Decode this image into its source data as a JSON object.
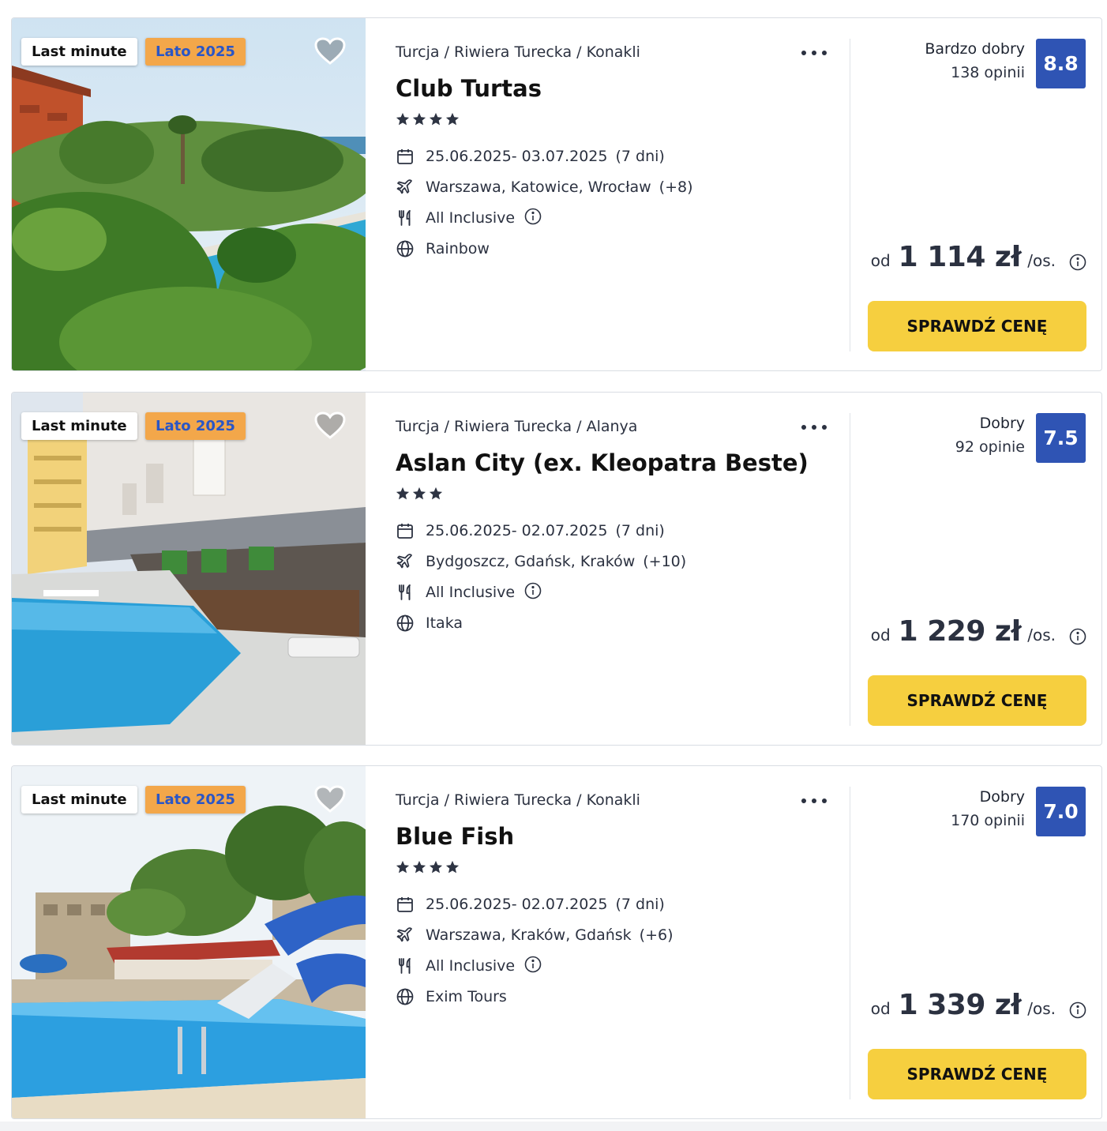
{
  "offers": [
    {
      "badges": {
        "last_minute": "Last minute",
        "season": "Lato 2025"
      },
      "breadcrumb": "Turcja / Riwiera Turecka / Konakli",
      "hotel_name": "Club Turtas",
      "stars": 4,
      "dates": "25.06.2025- 03.07.2025",
      "duration": "(7 dni)",
      "airports": "Warszawa, Katowice, Wrocław",
      "airports_extra": "(+8)",
      "board": "All Inclusive",
      "operator": "Rainbow",
      "rating_label": "Bardzo dobry",
      "review_count": "138 opinii",
      "score": "8.8",
      "price_prefix": "od",
      "price": "1 114 zł",
      "price_suffix": "/os.",
      "cta_label": "SPRAWDŹ CENĘ"
    },
    {
      "badges": {
        "last_minute": "Last minute",
        "season": "Lato 2025"
      },
      "breadcrumb": "Turcja / Riwiera Turecka / Alanya",
      "hotel_name": "Aslan City (ex. Kleopatra Beste)",
      "stars": 3,
      "dates": "25.06.2025- 02.07.2025",
      "duration": "(7 dni)",
      "airports": "Bydgoszcz, Gdańsk, Kraków",
      "airports_extra": "(+10)",
      "board": "All Inclusive",
      "operator": "Itaka",
      "rating_label": "Dobry",
      "review_count": "92 opinie",
      "score": "7.5",
      "price_prefix": "od",
      "price": "1 229 zł",
      "price_suffix": "/os.",
      "cta_label": "SPRAWDŹ CENĘ"
    },
    {
      "badges": {
        "last_minute": "Last minute",
        "season": "Lato 2025"
      },
      "breadcrumb": "Turcja / Riwiera Turecka / Konakli",
      "hotel_name": "Blue Fish",
      "stars": 4,
      "dates": "25.06.2025- 02.07.2025",
      "duration": "(7 dni)",
      "airports": "Warszawa, Kraków, Gdańsk",
      "airports_extra": "(+6)",
      "board": "All Inclusive",
      "operator": "Exim Tours",
      "rating_label": "Dobry",
      "review_count": "170 opinii",
      "score": "7.0",
      "price_prefix": "od",
      "price": "1 339 zł",
      "price_suffix": "/os.",
      "cta_label": "SPRAWDŹ CENĘ"
    }
  ],
  "icons": {
    "favorite": "heart-icon",
    "more": "more-dots-icon",
    "star": "star-icon",
    "dates": "calendar-icon",
    "airports": "plane-icon",
    "board": "cutlery-icon",
    "info": "info-icon",
    "operator": "globe-icon"
  },
  "colors": {
    "score_bg": "#2f54b4",
    "cta_bg": "#f6cf3f",
    "season_badge_bg": "#f3a74a",
    "season_badge_text": "#2a56c6",
    "text": "#2b3140"
  }
}
